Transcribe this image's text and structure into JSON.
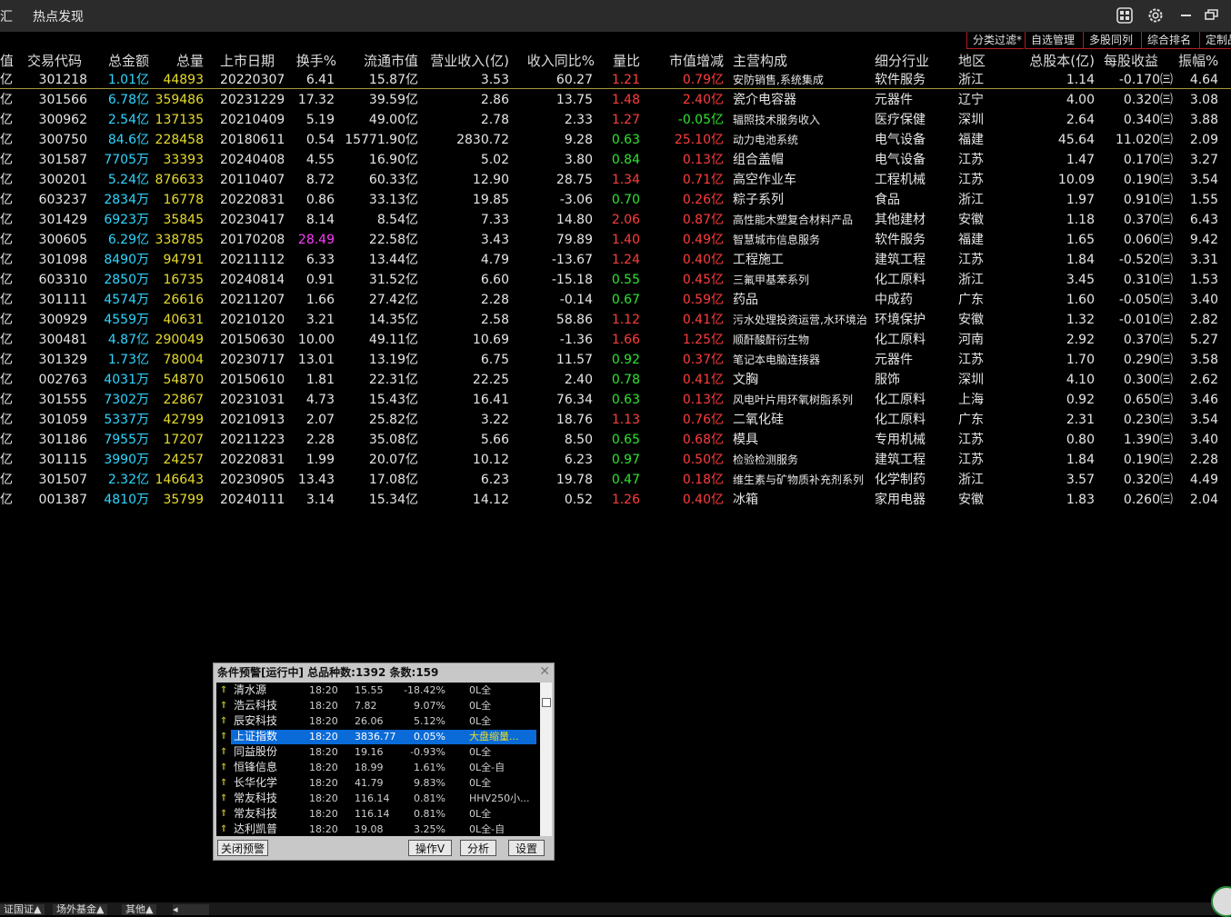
{
  "titlebar": {
    "menu1": "汇",
    "menu2": "热点发现"
  },
  "tabs": [
    "分类过滤*",
    "自选管理",
    "多股同列",
    "综合排名",
    "定制品"
  ],
  "headers": [
    "值",
    "交易代码",
    "总金额",
    "总量",
    "上市日期",
    "换手%",
    "流通市值",
    "营业收入(亿)",
    "收入同比%",
    "量比",
    "市值增减",
    "主营构成",
    "细分行业",
    "地区",
    "总股本(亿)",
    "每股收益",
    "振幅%"
  ],
  "rows": [
    {
      "a": "亿",
      "code": "301218",
      "amt": "1.01亿",
      "vol": "44893",
      "date": "20220307",
      "turn": "6.41",
      "mcap": "15.87亿",
      "rev": "3.53",
      "yoy": "60.27",
      "vr": "1.21",
      "chg": "0.79亿",
      "biz": "安防销售,系统集成",
      "ind": "软件服务",
      "reg": "浙江",
      "sh": "1.14",
      "eps": "-0.170㈢",
      "amp": "4.64"
    },
    {
      "a": "亿",
      "code": "301566",
      "amt": "6.78亿",
      "vol": "359486",
      "date": "20231229",
      "turn": "17.32",
      "mcap": "39.59亿",
      "rev": "2.86",
      "yoy": "13.75",
      "vr": "1.48",
      "chg": "2.40亿",
      "biz": "瓷介电容器",
      "ind": "元器件",
      "reg": "辽宁",
      "sh": "4.00",
      "eps": "0.320㈢",
      "amp": "3.08"
    },
    {
      "a": "亿",
      "code": "300962",
      "amt": "2.54亿",
      "vol": "137135",
      "date": "20210409",
      "turn": "5.19",
      "mcap": "49.00亿",
      "rev": "2.78",
      "yoy": "2.33",
      "vr": "1.27",
      "chg": "-0.05亿",
      "biz": "辐照技术服务收入",
      "ind": "医疗保健",
      "reg": "深圳",
      "sh": "2.64",
      "eps": "0.340㈢",
      "amp": "3.88"
    },
    {
      "a": "亿",
      "code": "300750",
      "amt": "84.6亿",
      "vol": "228458",
      "date": "20180611",
      "turn": "0.54",
      "mcap": "15771.90亿",
      "rev": "2830.72",
      "yoy": "9.28",
      "vr": "0.63",
      "chg": "25.10亿",
      "biz": "动力电池系统",
      "ind": "电气设备",
      "reg": "福建",
      "sh": "45.64",
      "eps": "11.020㈢",
      "amp": "2.09"
    },
    {
      "a": "亿",
      "code": "301587",
      "amt": "7705万",
      "vol": "33393",
      "date": "20240408",
      "turn": "4.55",
      "mcap": "16.90亿",
      "rev": "5.02",
      "yoy": "3.80",
      "vr": "0.84",
      "chg": "0.13亿",
      "biz": "组合盖帽",
      "ind": "电气设备",
      "reg": "江苏",
      "sh": "1.47",
      "eps": "0.170㈢",
      "amp": "3.27"
    },
    {
      "a": "亿",
      "code": "300201",
      "amt": "5.24亿",
      "vol": "876633",
      "date": "20110407",
      "turn": "8.72",
      "mcap": "60.33亿",
      "rev": "12.90",
      "yoy": "28.75",
      "vr": "1.34",
      "chg": "0.71亿",
      "biz": "高空作业车",
      "ind": "工程机械",
      "reg": "江苏",
      "sh": "10.09",
      "eps": "0.190㈢",
      "amp": "3.54"
    },
    {
      "a": "亿",
      "code": "603237",
      "amt": "2834万",
      "vol": "16778",
      "date": "20220831",
      "turn": "0.86",
      "mcap": "33.13亿",
      "rev": "19.85",
      "yoy": "-3.06",
      "vr": "0.70",
      "chg": "0.26亿",
      "biz": "粽子系列",
      "ind": "食品",
      "reg": "浙江",
      "sh": "1.97",
      "eps": "0.910㈢",
      "amp": "1.55"
    },
    {
      "a": "亿",
      "code": "301429",
      "amt": "6923万",
      "vol": "35845",
      "date": "20230417",
      "turn": "8.14",
      "mcap": "8.54亿",
      "rev": "7.33",
      "yoy": "14.80",
      "vr": "2.06",
      "chg": "0.87亿",
      "biz": "高性能木塑复合材料产品",
      "ind": "其他建材",
      "reg": "安徽",
      "sh": "1.18",
      "eps": "0.370㈢",
      "amp": "6.43"
    },
    {
      "a": "亿",
      "code": "300605",
      "amt": "6.29亿",
      "vol": "338785",
      "date": "20170208",
      "turn": "28.49",
      "mcap": "22.58亿",
      "rev": "3.43",
      "yoy": "79.89",
      "vr": "1.40",
      "chg": "0.49亿",
      "biz": "智慧城市信息服务",
      "ind": "软件服务",
      "reg": "福建",
      "sh": "1.65",
      "eps": "0.060㈢",
      "amp": "9.42"
    },
    {
      "a": "亿",
      "code": "301098",
      "amt": "8490万",
      "vol": "94791",
      "date": "20211112",
      "turn": "6.33",
      "mcap": "13.44亿",
      "rev": "4.79",
      "yoy": "-13.67",
      "vr": "1.24",
      "chg": "0.40亿",
      "biz": "工程施工",
      "ind": "建筑工程",
      "reg": "江苏",
      "sh": "1.84",
      "eps": "-0.520㈢",
      "amp": "3.31"
    },
    {
      "a": "亿",
      "code": "603310",
      "amt": "2850万",
      "vol": "16735",
      "date": "20240814",
      "turn": "0.91",
      "mcap": "31.52亿",
      "rev": "6.60",
      "yoy": "-15.18",
      "vr": "0.55",
      "chg": "0.45亿",
      "biz": "三氟甲基苯系列",
      "ind": "化工原料",
      "reg": "浙江",
      "sh": "3.45",
      "eps": "0.310㈢",
      "amp": "1.53"
    },
    {
      "a": "亿",
      "code": "301111",
      "amt": "4574万",
      "vol": "26616",
      "date": "20211207",
      "turn": "1.66",
      "mcap": "27.42亿",
      "rev": "2.28",
      "yoy": "-0.14",
      "vr": "0.67",
      "chg": "0.59亿",
      "biz": "药品",
      "ind": "中成药",
      "reg": "广东",
      "sh": "1.60",
      "eps": "-0.050㈢",
      "amp": "3.40"
    },
    {
      "a": "亿",
      "code": "300929",
      "amt": "4559万",
      "vol": "40631",
      "date": "20210120",
      "turn": "3.21",
      "mcap": "14.35亿",
      "rev": "2.58",
      "yoy": "58.86",
      "vr": "1.12",
      "chg": "0.41亿",
      "biz": "污水处理投资运营,水环境治",
      "ind": "环境保护",
      "reg": "安徽",
      "sh": "1.32",
      "eps": "-0.010㈢",
      "amp": "2.82"
    },
    {
      "a": "亿",
      "code": "300481",
      "amt": "4.87亿",
      "vol": "290049",
      "date": "20150630",
      "turn": "10.00",
      "mcap": "49.11亿",
      "rev": "10.69",
      "yoy": "-1.36",
      "vr": "1.66",
      "chg": "1.25亿",
      "biz": "顺酐酸酐衍生物",
      "ind": "化工原料",
      "reg": "河南",
      "sh": "2.92",
      "eps": "0.370㈢",
      "amp": "5.27"
    },
    {
      "a": "亿",
      "code": "301329",
      "amt": "1.73亿",
      "vol": "78004",
      "date": "20230717",
      "turn": "13.01",
      "mcap": "13.19亿",
      "rev": "6.75",
      "yoy": "11.57",
      "vr": "0.92",
      "chg": "0.37亿",
      "biz": "笔记本电脑连接器",
      "ind": "元器件",
      "reg": "江苏",
      "sh": "1.70",
      "eps": "0.290㈢",
      "amp": "3.58"
    },
    {
      "a": "亿",
      "code": "002763",
      "amt": "4031万",
      "vol": "54870",
      "date": "20150610",
      "turn": "1.81",
      "mcap": "22.31亿",
      "rev": "22.25",
      "yoy": "2.40",
      "vr": "0.78",
      "chg": "0.41亿",
      "biz": "文胸",
      "ind": "服饰",
      "reg": "深圳",
      "sh": "4.10",
      "eps": "0.300㈢",
      "amp": "2.62"
    },
    {
      "a": "亿",
      "code": "301555",
      "amt": "7302万",
      "vol": "22867",
      "date": "20231031",
      "turn": "4.73",
      "mcap": "15.43亿",
      "rev": "16.41",
      "yoy": "76.34",
      "vr": "0.63",
      "chg": "0.13亿",
      "biz": "风电叶片用环氧树脂系列",
      "ind": "化工原料",
      "reg": "上海",
      "sh": "0.92",
      "eps": "0.650㈢",
      "amp": "3.46"
    },
    {
      "a": "亿",
      "code": "301059",
      "amt": "5337万",
      "vol": "42799",
      "date": "20210913",
      "turn": "2.07",
      "mcap": "25.82亿",
      "rev": "3.22",
      "yoy": "18.76",
      "vr": "1.13",
      "chg": "0.76亿",
      "biz": "二氧化硅",
      "ind": "化工原料",
      "reg": "广东",
      "sh": "2.31",
      "eps": "0.230㈢",
      "amp": "3.54"
    },
    {
      "a": "亿",
      "code": "301186",
      "amt": "7955万",
      "vol": "17207",
      "date": "20211223",
      "turn": "2.28",
      "mcap": "35.08亿",
      "rev": "5.66",
      "yoy": "8.50",
      "vr": "0.65",
      "chg": "0.68亿",
      "biz": "模具",
      "ind": "专用机械",
      "reg": "江苏",
      "sh": "0.80",
      "eps": "1.390㈢",
      "amp": "3.40"
    },
    {
      "a": "亿",
      "code": "301115",
      "amt": "3990万",
      "vol": "24257",
      "date": "20220831",
      "turn": "1.99",
      "mcap": "20.07亿",
      "rev": "10.12",
      "yoy": "6.23",
      "vr": "0.97",
      "chg": "0.50亿",
      "biz": "检验检测服务",
      "ind": "建筑工程",
      "reg": "江苏",
      "sh": "1.84",
      "eps": "0.190㈢",
      "amp": "2.28"
    },
    {
      "a": "亿",
      "code": "301507",
      "amt": "2.32亿",
      "vol": "146643",
      "date": "20230905",
      "turn": "13.43",
      "mcap": "17.08亿",
      "rev": "6.23",
      "yoy": "19.78",
      "vr": "0.47",
      "chg": "0.18亿",
      "biz": "维生素与矿物质补充剂系列",
      "ind": "化学制药",
      "reg": "浙江",
      "sh": "3.57",
      "eps": "0.320㈢",
      "amp": "4.49"
    },
    {
      "a": "亿",
      "code": "001387",
      "amt": "4810万",
      "vol": "35799",
      "date": "20240111",
      "turn": "3.14",
      "mcap": "15.34亿",
      "rev": "14.12",
      "yoy": "0.52",
      "vr": "1.26",
      "chg": "0.40亿",
      "biz": "冰箱",
      "ind": "家用电器",
      "reg": "安徽",
      "sh": "1.83",
      "eps": "0.260㈢",
      "amp": "2.04"
    }
  ],
  "alert": {
    "title": "条件预警[运行中] 总品种数:1392 条数:159",
    "close": "✕",
    "items": [
      {
        "name": "清水源",
        "time": "18:20",
        "price": "15.55",
        "pct": "-18.42%",
        "type": "0L全"
      },
      {
        "name": "浩云科技",
        "time": "18:20",
        "price": "7.82",
        "pct": "9.07%",
        "type": "0L全"
      },
      {
        "name": "辰安科技",
        "time": "18:20",
        "price": "26.06",
        "pct": "5.12%",
        "type": "0L全"
      },
      {
        "name": "上证指数",
        "time": "18:20",
        "price": "3836.77",
        "pct": "0.05%",
        "type": "大盘缩量..."
      },
      {
        "name": "同益股份",
        "time": "18:20",
        "price": "19.16",
        "pct": "-0.93%",
        "type": "0L全"
      },
      {
        "name": "恒锋信息",
        "time": "18:20",
        "price": "18.99",
        "pct": "1.61%",
        "type": "0L全-自"
      },
      {
        "name": "长华化学",
        "time": "18:20",
        "price": "41.79",
        "pct": "9.83%",
        "type": "0L全"
      },
      {
        "name": "常友科技",
        "time": "18:20",
        "price": "116.14",
        "pct": "0.81%",
        "type": "HHV250小..."
      },
      {
        "name": "常友科技",
        "time": "18:20",
        "price": "116.14",
        "pct": "0.81%",
        "type": "0L全"
      },
      {
        "name": "达利凯普",
        "time": "18:20",
        "price": "19.08",
        "pct": "3.25%",
        "type": "0L全-自"
      }
    ],
    "btn_close": "关闭预警",
    "btn_op": "操作V",
    "btn_analyze": "分析",
    "btn_settings": "设置"
  },
  "bottom_tabs": [
    "证国证▲",
    "场外基金▲",
    "其他▲"
  ]
}
